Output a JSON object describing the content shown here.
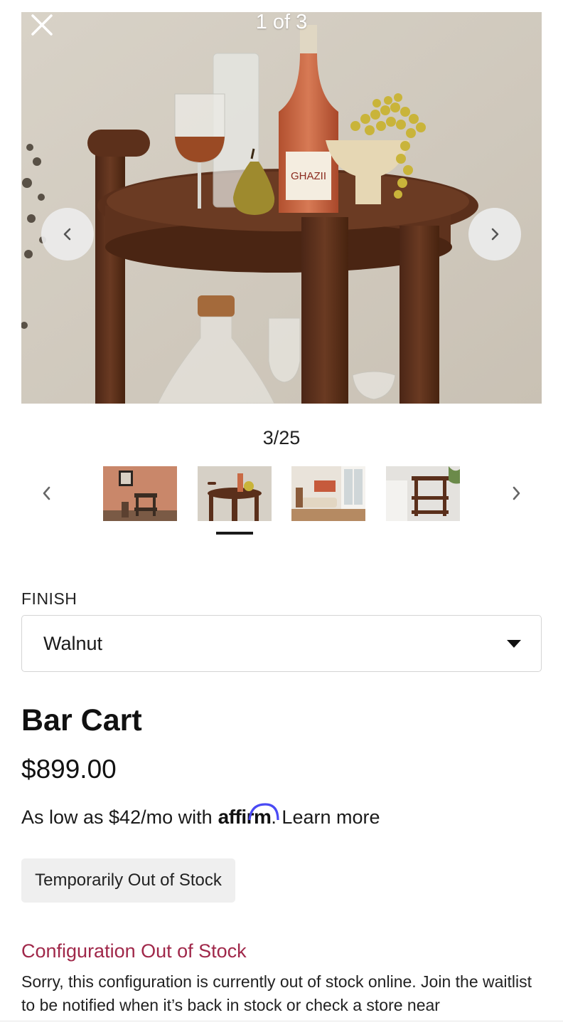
{
  "gallery": {
    "slide_counter": "1 of 3",
    "image_counter": "3/25",
    "thumbnails": [
      {
        "name": "thumb-1",
        "selected": false
      },
      {
        "name": "thumb-2",
        "selected": true
      },
      {
        "name": "thumb-3",
        "selected": false
      },
      {
        "name": "thumb-4",
        "selected": false
      }
    ]
  },
  "bottle_label": "GHAZII",
  "finish": {
    "label": "FINISH",
    "selected": "Walnut"
  },
  "product": {
    "title": "Bar Cart",
    "price": "$899.00",
    "financing_prefix": "As low as $42/mo with",
    "financing_brand": "affirm",
    "financing_suffix": ". Learn more",
    "stock_status": "Temporarily Out of Stock"
  },
  "notice": {
    "heading": "Configuration Out of Stock",
    "body": "Sorry, this configuration is currently out of stock online. Join the waitlist to be notified when it’s back in stock or check a store near"
  },
  "colors": {
    "accent_red": "#a0284a",
    "affirm_purple": "#4a4af4",
    "walnut": "#5a301c"
  },
  "icons": {
    "close": "close-icon",
    "prev": "chevron-left-icon",
    "next": "chevron-right-icon",
    "dropdown": "caret-down-icon"
  }
}
